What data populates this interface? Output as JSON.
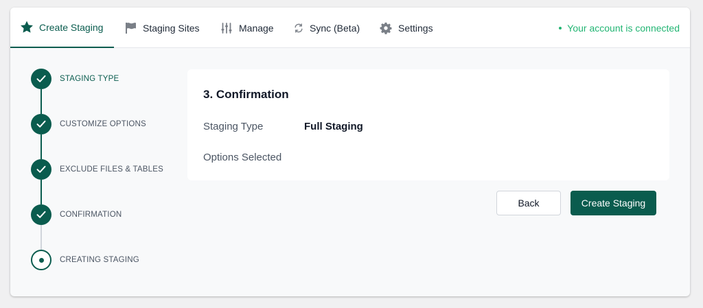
{
  "nav": {
    "tabs": [
      {
        "label": "Create Staging",
        "icon": "star-icon"
      },
      {
        "label": "Staging Sites",
        "icon": "flag-icon"
      },
      {
        "label": "Manage",
        "icon": "sliders-icon"
      },
      {
        "label": "Sync (Beta)",
        "icon": "sync-icon"
      },
      {
        "label": "Settings",
        "icon": "gear-icon"
      }
    ],
    "status": "Your account is connected"
  },
  "stepper": {
    "steps": [
      {
        "label": "STAGING TYPE",
        "state": "done"
      },
      {
        "label": "CUSTOMIZE OPTIONS",
        "state": "done"
      },
      {
        "label": "EXCLUDE FILES & TABLES",
        "state": "done"
      },
      {
        "label": "CONFIRMATION",
        "state": "done"
      },
      {
        "label": "CREATING STAGING",
        "state": "current"
      }
    ]
  },
  "confirmation": {
    "title": "3. Confirmation",
    "staging_type_label": "Staging Type",
    "staging_type_value": "Full Staging",
    "options_label": "Options Selected"
  },
  "actions": {
    "back_label": "Back",
    "create_label": "Create Staging"
  },
  "colors": {
    "brand": "#0a5c4e",
    "connected": "#22b573"
  }
}
